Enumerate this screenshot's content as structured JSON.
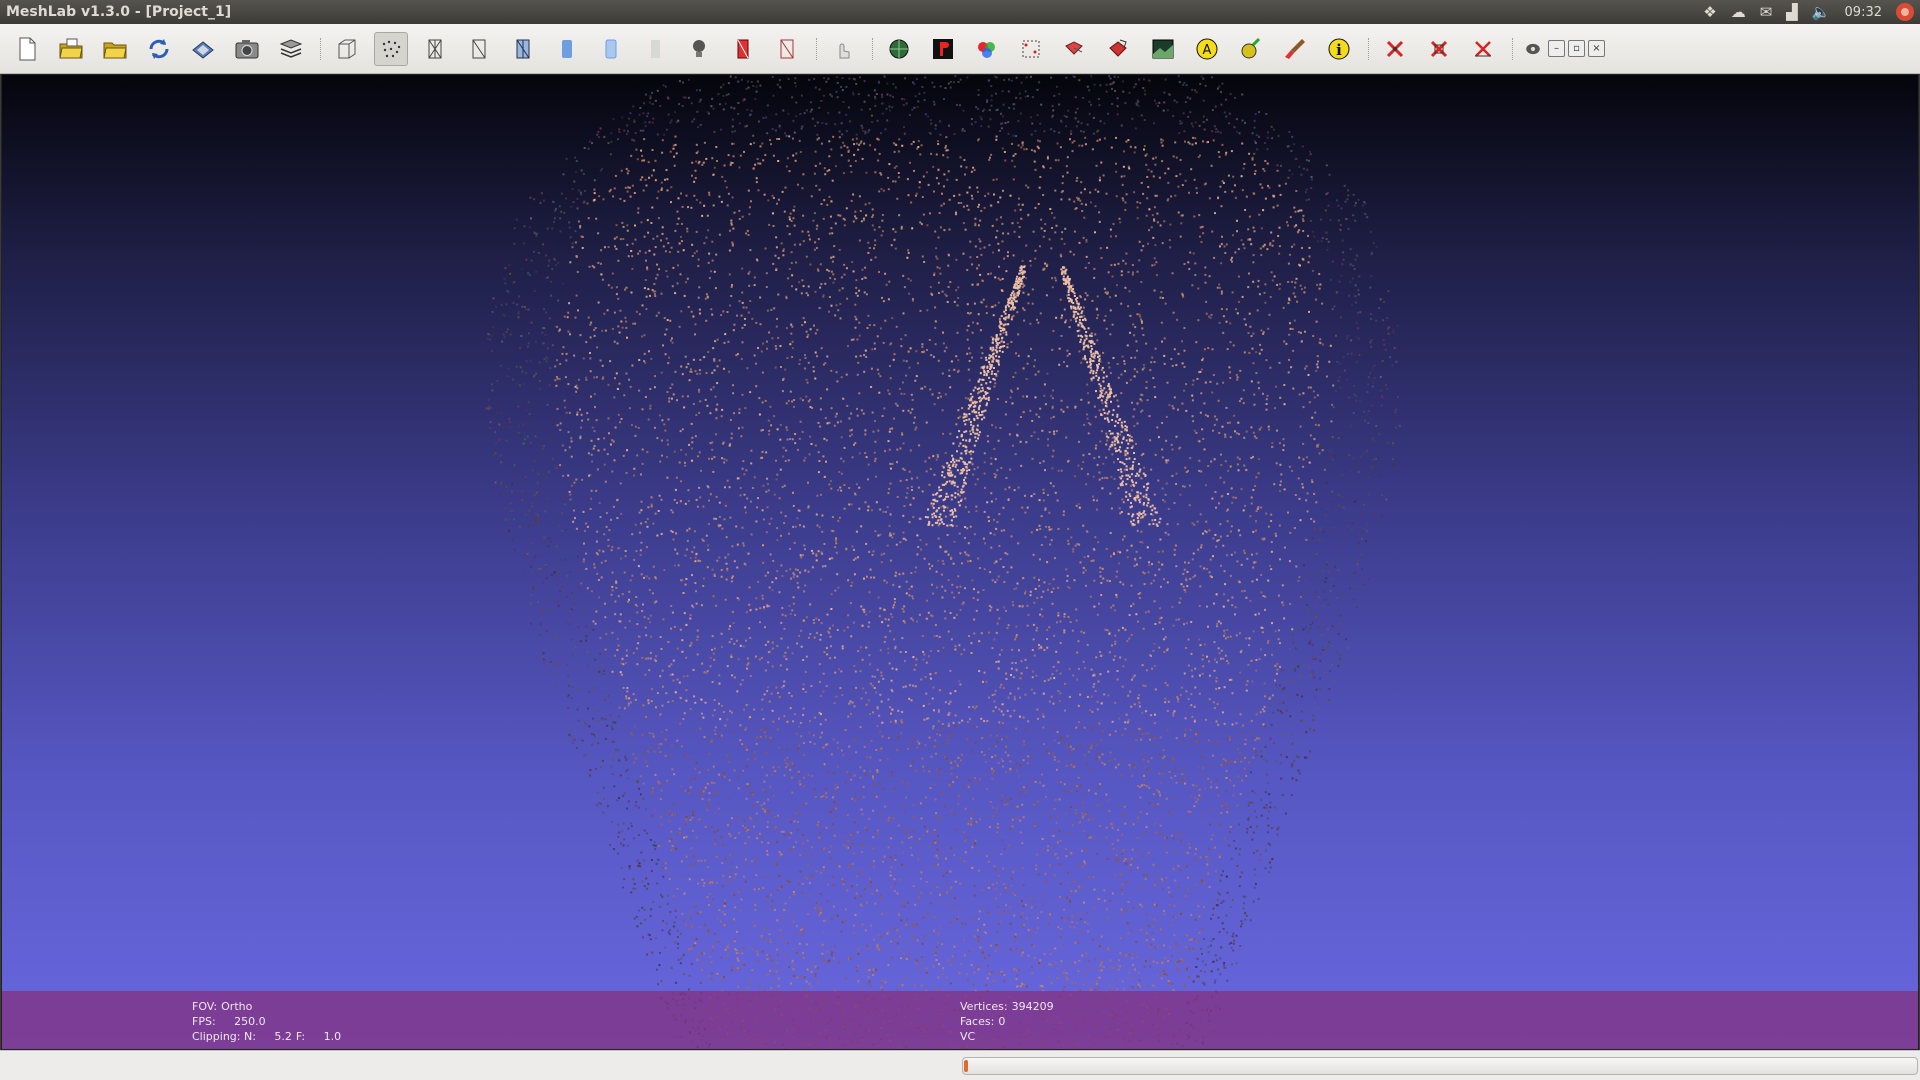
{
  "window": {
    "title": "MeshLab v1.3.0 - [Project_1]"
  },
  "tray": {
    "clock": "09:32"
  },
  "toolbar": {
    "groups": [
      [
        "new-project",
        "open-project",
        "open-mesh",
        "reload",
        "save-snapshot-light",
        "snapshot",
        "layers"
      ],
      [
        "render-bbox",
        "render-points",
        "render-wireframe",
        "render-hiddenlines",
        "render-flatlines",
        "render-flat",
        "render-smooth",
        "render-texture",
        "lighting",
        "backface",
        "select-faces"
      ],
      [
        "manipulator"
      ],
      [
        "fill-mesh",
        "paint-pdf",
        "color-tools",
        "select-vertices",
        "align",
        "measure",
        "raster",
        "annotate-a",
        "pick-tool",
        "paint-brush",
        "info"
      ],
      [
        "delete-vertices",
        "delete-faces",
        "delete-selection"
      ],
      [
        "camera-toggle"
      ]
    ]
  },
  "viewport": {
    "fov_label": "FOV:",
    "fov_value": "Ortho",
    "fps_label": "FPS:",
    "fps_value": "250.0",
    "clipping_label": "Clipping: N:",
    "clipping_n": "5.2",
    "clipping_f_label": "F:",
    "clipping_f": "1.0",
    "vertices_label": "Vertices:",
    "vertices_value": "394209",
    "faces_label": "Faces:",
    "faces_value": "0",
    "color_mode": "VC"
  },
  "status": {
    "progress": 0.002
  },
  "colors": {
    "info_bar": "#823282",
    "accent_progress": "#e06a2c",
    "viewport_top": "#05050c",
    "viewport_bottom": "#6868df"
  }
}
